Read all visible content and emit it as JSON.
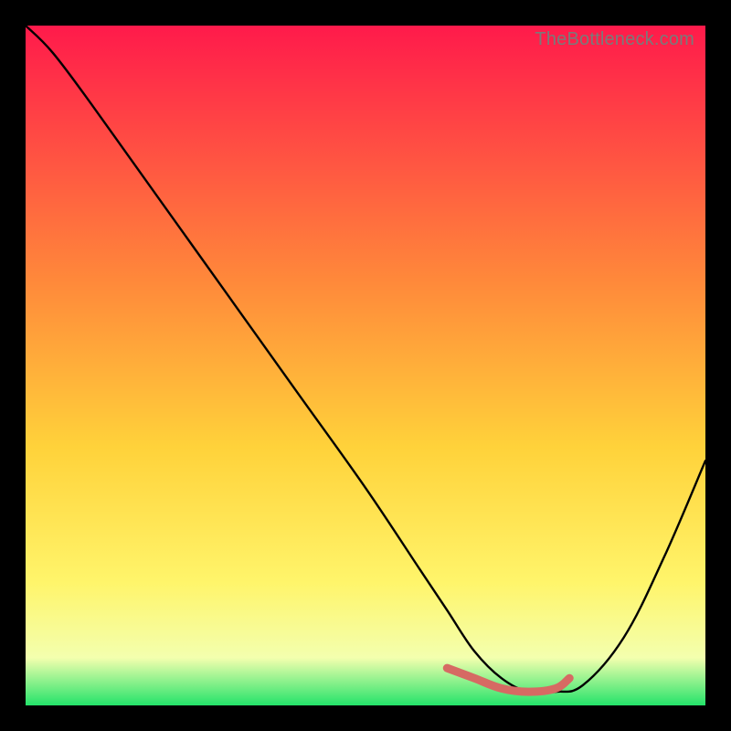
{
  "watermark": "TheBottleneck.com",
  "colors": {
    "bg": "#000000",
    "grad_top": "#ff1a4b",
    "grad_mid_upper": "#ff6e3a",
    "grad_mid": "#ffd23a",
    "grad_mid_lower": "#fff56b",
    "grad_low": "#f7ffb0",
    "grad_bottom": "#24e36a",
    "curve": "#000000",
    "highlight": "#d66a63"
  },
  "chart_data": {
    "type": "line",
    "title": "",
    "xlabel": "",
    "ylabel": "",
    "xlim": [
      0,
      100
    ],
    "ylim": [
      0,
      100
    ],
    "series": [
      {
        "name": "bottleneck-curve",
        "x": [
          0,
          4,
          10,
          20,
          30,
          40,
          50,
          58,
          62,
          66,
          70,
          74,
          78,
          82,
          88,
          94,
          100
        ],
        "y": [
          100,
          96,
          88,
          74,
          60,
          46,
          32,
          20,
          14,
          8,
          4,
          2,
          2,
          3,
          10,
          22,
          36
        ]
      }
    ],
    "highlight_segment": {
      "name": "minimum-band",
      "x": [
        62,
        66,
        70,
        74,
        78,
        80
      ],
      "y": [
        5.5,
        4,
        2.5,
        2,
        2.5,
        4
      ]
    },
    "gradient_stops": [
      {
        "offset": 0,
        "value": 100
      },
      {
        "offset": 38,
        "value": 62
      },
      {
        "offset": 62,
        "value": 38
      },
      {
        "offset": 82,
        "value": 18
      },
      {
        "offset": 93,
        "value": 7
      },
      {
        "offset": 100,
        "value": 0
      }
    ]
  }
}
